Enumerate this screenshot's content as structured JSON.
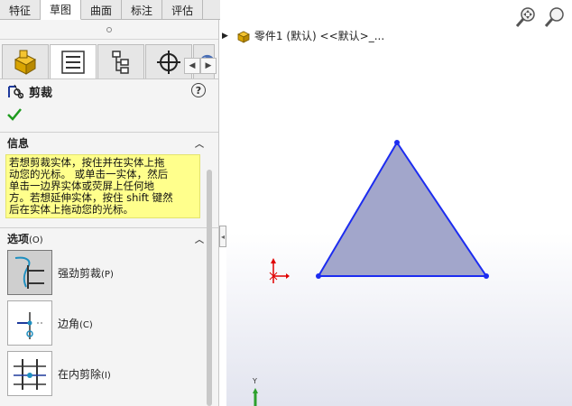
{
  "tabs": [
    {
      "label": "特征",
      "active": false
    },
    {
      "label": "草图",
      "active": true
    },
    {
      "label": "曲面",
      "active": false
    },
    {
      "label": "标注",
      "active": false
    },
    {
      "label": "评估",
      "active": false
    }
  ],
  "manager_tabs": [
    "feature-manager-icon",
    "property-manager-icon",
    "configuration-manager-icon",
    "dimxpert-icon",
    "appearance-icon"
  ],
  "feature": {
    "title": "剪裁",
    "help": "?",
    "ok_icon": "check-icon"
  },
  "info": {
    "heading": "信息",
    "lines": [
      "若想剪裁实体，按住并在实体上拖",
      "动您的光标。 或单击一实体，然后",
      "单击一边界实体或荧屏上任何地",
      "方。若想延伸实体，按住 shift 键然",
      "后在实体上拖动您的光标。"
    ]
  },
  "options": {
    "heading": "选项",
    "heading_key": "(O)",
    "items": [
      {
        "label": "强劲剪裁",
        "key": "(P)",
        "selected": true,
        "icon": "power-trim-icon"
      },
      {
        "label": "边角",
        "key": "(C)",
        "selected": false,
        "icon": "corner-trim-icon"
      },
      {
        "label": "在内剪除",
        "key": "(I)",
        "selected": false,
        "icon": "trim-inside-icon"
      }
    ]
  },
  "tree": {
    "label": "零件1 (默认) <<默认>_..."
  },
  "axis": {
    "y_label": "Y"
  },
  "colors": {
    "triangle_fill": "#a2a6cb",
    "triangle_stroke": "#1c2cf0",
    "origin": "#e00000"
  }
}
